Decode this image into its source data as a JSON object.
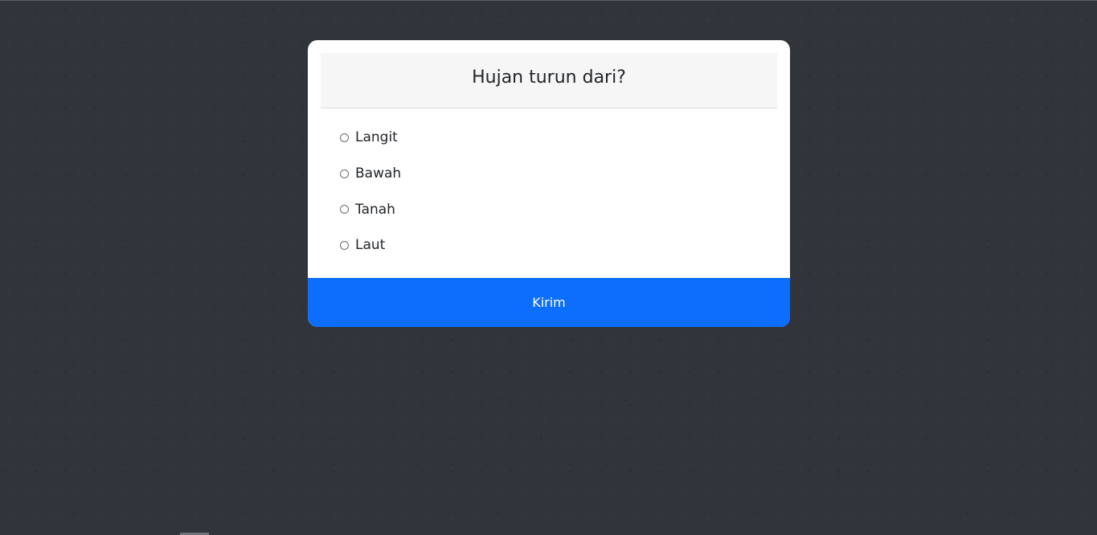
{
  "quiz": {
    "question": "Hujan turun dari?",
    "options": [
      {
        "label": "Langit",
        "selected": false
      },
      {
        "label": "Bawah",
        "selected": false
      },
      {
        "label": "Tanah",
        "selected": false
      },
      {
        "label": "Laut",
        "selected": false
      }
    ],
    "submit_label": "Kirim"
  },
  "colors": {
    "background": "#31353b",
    "card": "#ffffff",
    "header": "#f6f6f6",
    "accent": "#0d6efd"
  }
}
